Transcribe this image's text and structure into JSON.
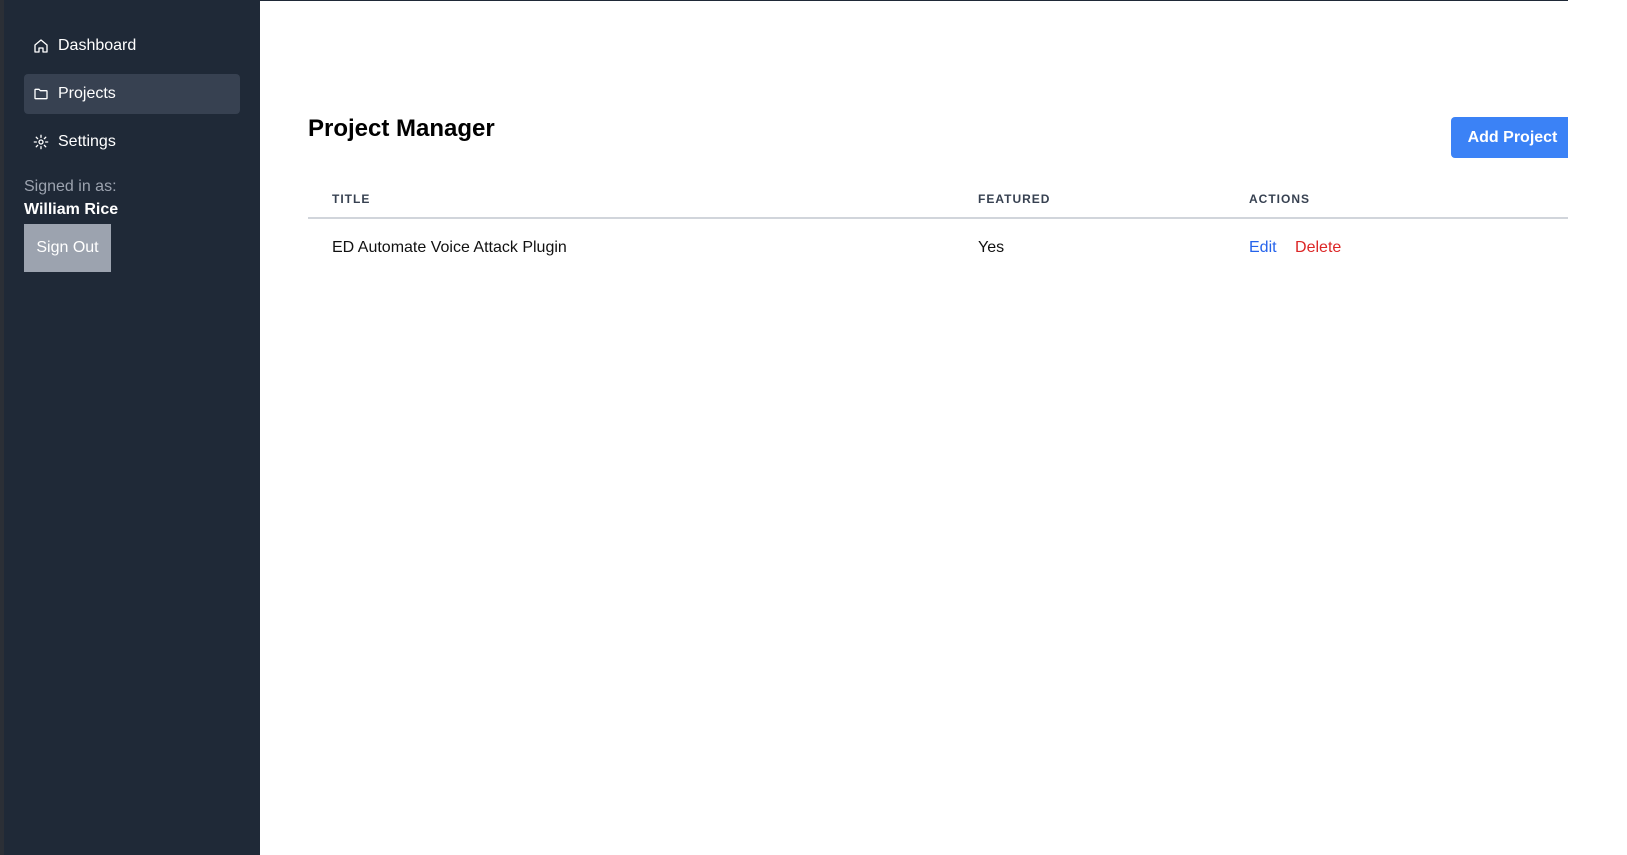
{
  "sidebar": {
    "items": [
      {
        "label": "Dashboard",
        "icon": "home-icon"
      },
      {
        "label": "Projects",
        "icon": "folder-icon",
        "active": true
      },
      {
        "label": "Settings",
        "icon": "gear-icon"
      }
    ],
    "signed_in_label": "Signed in as:",
    "user_name": "William Rice",
    "sign_out_label": "Sign Out"
  },
  "main": {
    "title": "Project Manager",
    "add_button_label": "Add Project",
    "table": {
      "headers": [
        "TITLE",
        "FEATURED",
        "ACTIONS"
      ],
      "rows": [
        {
          "title": "ED Automate Voice Attack Plugin",
          "featured": "Yes",
          "edit": "Edit",
          "delete": "Delete"
        }
      ]
    }
  },
  "colors": {
    "sidebar_bg": "#1f2937",
    "active_item_bg": "#374151",
    "accent": "#3b82f6",
    "edit": "#2563eb",
    "delete": "#dc2626"
  }
}
